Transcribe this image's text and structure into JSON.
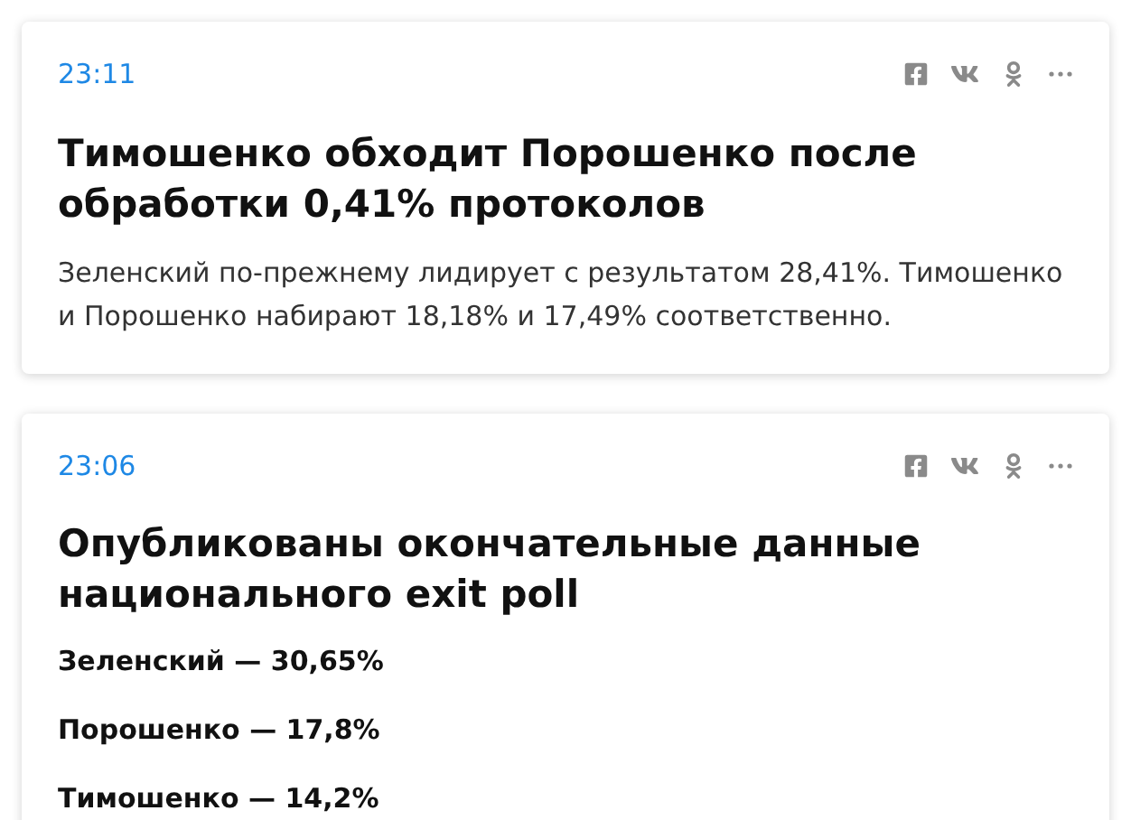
{
  "posts": [
    {
      "time": "23:11",
      "title": "Тимошенко обходит Порошенко после обработки 0,41% протоколов",
      "paragraphs": [
        {
          "kind": "text",
          "text": "Зеленский по-прежнему лидирует с результатом 28,41%. Тимошенко и Порошенко набирают 18,18% и 17,49% соответственно."
        }
      ]
    },
    {
      "time": "23:06",
      "title": "Опубликованы окончательные данные национального exit poll",
      "paragraphs": [
        {
          "kind": "bold",
          "text": "Зеленский — 30,65%"
        },
        {
          "kind": "bold",
          "text": "Порошенко — 17,8%"
        },
        {
          "kind": "bold",
          "text": "Тимошенко — 14,2%"
        }
      ]
    }
  ]
}
